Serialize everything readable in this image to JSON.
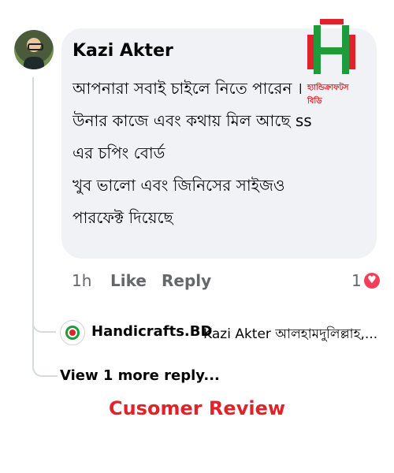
{
  "colors": {
    "bubble_bg": "#f0f2f5",
    "meta_gray": "#65676b",
    "brand_red": "#e0222b",
    "brand_green": "#1e9b3a",
    "heart": "#f33e58"
  },
  "comment": {
    "author": "Kazi Akter",
    "text": "আপনারা সবাই চাইলে নিতে পারেন ।\nউনার কাজে এবং কথায় মিল আছে ss\nএর চপিং বোর্ড\n খুব ভালো এবং জিনিসের সাইজও\nপারফেক্ট দিয়েছে",
    "time": "1h",
    "like_label": "Like",
    "reply_label": "Reply",
    "reaction_count": "1",
    "reaction_icon": "heart-icon"
  },
  "logo": {
    "caption": "হ্যান্ডিক্রাফটস বিডি"
  },
  "reply": {
    "author": "Handicrafts.BD",
    "text": "Kazi Akter আলহামদুলিল্লাহ,..."
  },
  "view_more_label": "View 1 more reply...",
  "caption": "Cusomer Review"
}
